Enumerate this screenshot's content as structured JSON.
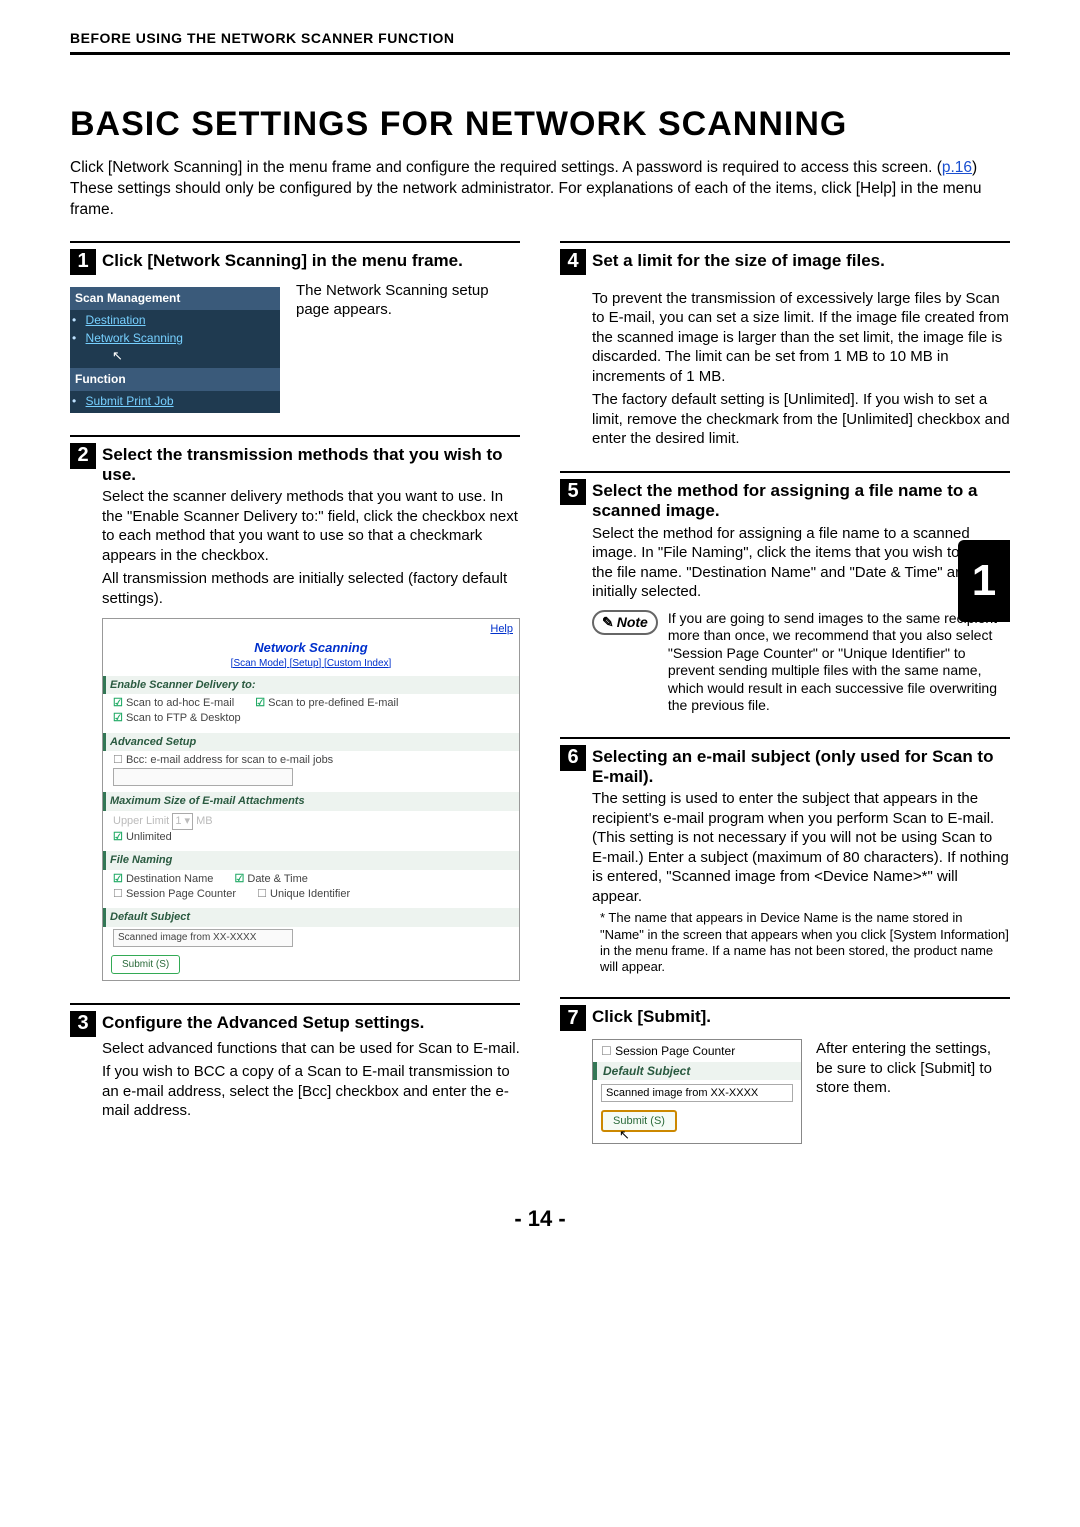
{
  "header": {
    "running_title": "BEFORE USING THE NETWORK SCANNER FUNCTION",
    "page_title": "BASIC SETTINGS FOR NETWORK SCANNING",
    "intro_a": "Click [Network Scanning] in the menu frame and configure the required settings. A password is required to access this screen. (",
    "intro_link": "p.16",
    "intro_b": ") These settings should only be configured by the network administrator. For explanations of each of the items, click [Help] in the menu frame."
  },
  "chapter_tab": "1",
  "page_number": "- 14 -",
  "steps": {
    "s1": {
      "num": "1",
      "title": "Click [Network Scanning] in the menu frame.",
      "side_text": "The Network Scanning setup page appears.",
      "menu": {
        "h1": "Scan Management",
        "destination": "Destination",
        "network_scanning": "Network Scanning",
        "h2": "Function",
        "submit_print": "Submit Print Job"
      }
    },
    "s2": {
      "num": "2",
      "title": "Select the transmission methods that you wish to use.",
      "p1": "Select the scanner delivery methods that you want to use. In the \"Enable Scanner Delivery to:\" field, click the checkbox next to each method that you want to use so that a checkmark appears in the checkbox.",
      "p2": "All transmission methods are initially selected (factory default settings).",
      "panel": {
        "help": "Help",
        "title": "Network Scanning",
        "sublinks": "[Scan Mode] [Setup] [Custom Index]",
        "sect_enable": "Enable Scanner Delivery to:",
        "chk_adhoc": "Scan to ad-hoc E-mail",
        "chk_predef": "Scan to pre-defined E-mail",
        "chk_ftp": "Scan to FTP & Desktop",
        "sect_adv": "Advanced Setup",
        "chk_bcc": "Bcc: e-mail address for scan to e-mail jobs",
        "sect_max": "Maximum Size of E-mail Attachments",
        "upper_limit_lbl": "Upper Limit",
        "upper_limit_val": "1",
        "upper_limit_unit": "MB",
        "chk_unlimited": "Unlimited",
        "sect_naming": "File Naming",
        "chk_dest": "Destination Name",
        "chk_date": "Date & Time",
        "chk_session": "Session Page Counter",
        "chk_unique": "Unique Identifier",
        "sect_subject": "Default Subject",
        "input_subject": "Scanned image from XX-XXXX",
        "submit": "Submit (S)"
      }
    },
    "s3": {
      "num": "3",
      "title": "Configure the Advanced Setup settings.",
      "p1": "Select advanced functions that can be used for Scan to E-mail.",
      "p2": "If you wish to BCC a copy of a Scan to E-mail transmission to an e-mail address, select the [Bcc] checkbox and enter the e-mail address."
    },
    "s4": {
      "num": "4",
      "title": "Set a limit for the size of image files.",
      "p1": "To prevent the transmission of excessively large files by Scan to E-mail, you can set a size limit. If the image file created from the scanned image is larger than the set limit, the image file is discarded. The limit can be set from 1 MB to 10 MB in increments of 1 MB.",
      "p2": "The factory default setting is [Unlimited]. If you wish to set a limit, remove the checkmark from the [Unlimited] checkbox and enter the desired limit."
    },
    "s5": {
      "num": "5",
      "title": "Select the method for assigning a file name to a scanned image.",
      "p1": "Select the method for assigning a file name to a scanned image. In \"File Naming\", click the items that you wish to use in the file name. \"Destination Name\" and \"Date & Time\" are initially selected.",
      "note_label": "Note",
      "note_text": "If you are going to send images to the same recipient more than once, we recommend that you also select \"Session Page Counter\" or \"Unique Identifier\" to prevent sending multiple files with the same name, which would result in each successive file overwriting the previous file."
    },
    "s6": {
      "num": "6",
      "title": "Selecting an e-mail subject (only used for Scan to E-mail).",
      "p1": "The setting is used to enter the subject that appears in the recipient's e-mail program when you perform Scan to E-mail. (This setting is not necessary if you will not be using Scan to E-mail.) Enter a subject (maximum of 80 characters). If nothing is entered, \"Scanned image from <Device Name>*\" will appear.",
      "foot": "* The name that appears in Device Name is the name stored in \"Name\" in the screen that appears when you click [System Information] in the menu frame. If a name has not been stored, the product name will appear."
    },
    "s7": {
      "num": "7",
      "title": "Click [Submit].",
      "side_text": "After entering the settings, be sure to click [Submit] to store them.",
      "box": {
        "chk_session": "Session Page Counter",
        "sect_subject": "Default Subject",
        "input_subject": "Scanned image from XX-XXXX",
        "submit": "Submit (S)"
      }
    }
  }
}
